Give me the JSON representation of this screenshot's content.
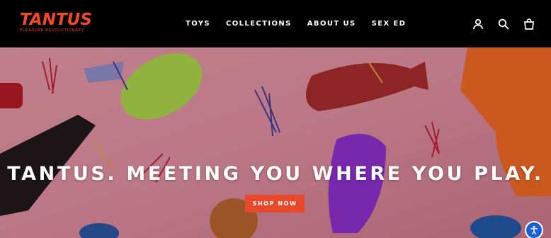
{
  "brand": {
    "logo_text": "TANTUS",
    "tagline": "PLEASURE REVOLUTIONARY",
    "color": "#f04a2a"
  },
  "nav": {
    "items": [
      {
        "label": "TOYS"
      },
      {
        "label": "COLLECTIONS"
      },
      {
        "label": "ABOUT US"
      },
      {
        "label": "SEX ED"
      }
    ]
  },
  "header_icons": [
    "account-icon",
    "search-icon",
    "cart-icon"
  ],
  "hero": {
    "headline": "TANTUS. MEETING YOU WHERE YOU PLAY.",
    "cta_label": "SHOP NOW",
    "cta_color": "#e8492b",
    "background_color": "#d58f9a"
  },
  "accessibility_widget": {
    "icon": "accessibility-icon",
    "color": "#1b5fd6"
  }
}
